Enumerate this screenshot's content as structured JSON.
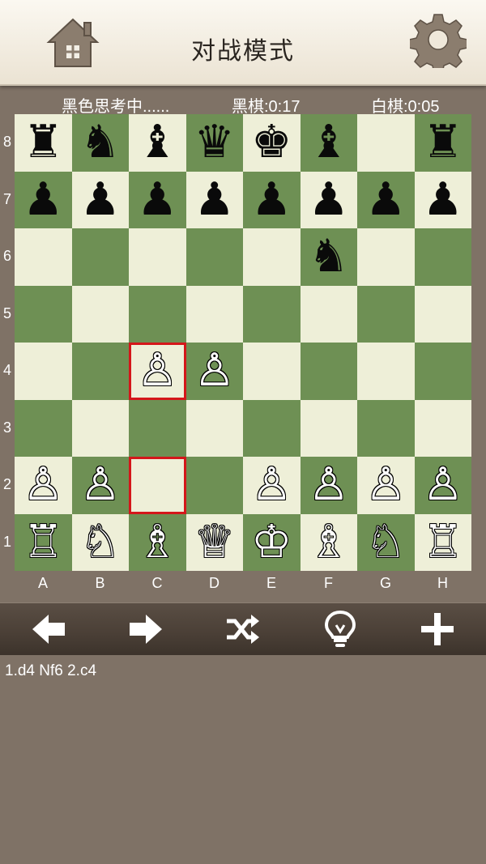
{
  "header": {
    "title": "对战模式",
    "home_icon": "home-icon",
    "settings_icon": "gear-icon"
  },
  "status": {
    "thinking": "黑色思考中......",
    "black_clock": "黑棋:0:17",
    "white_clock": "白棋:0:05"
  },
  "board": {
    "ranks": [
      "8",
      "7",
      "6",
      "5",
      "4",
      "3",
      "2",
      "1"
    ],
    "files": [
      "A",
      "B",
      "C",
      "D",
      "E",
      "F",
      "G",
      "H"
    ],
    "light_color": "#eeefd8",
    "dark_color": "#6e9054",
    "highlight_color": "#d4161a",
    "highlighted_squares": [
      "c4",
      "c2"
    ],
    "position": [
      [
        "br",
        "bn",
        "bb",
        "bq",
        "bk",
        "bb",
        "",
        "br"
      ],
      [
        "bp",
        "bp",
        "bp",
        "bp",
        "bp",
        "bp",
        "bp",
        "bp"
      ],
      [
        "",
        "",
        "",
        "",
        "",
        "bn",
        "",
        ""
      ],
      [
        "",
        "",
        "",
        "",
        "",
        "",
        "",
        ""
      ],
      [
        "",
        "",
        "wp",
        "wp",
        "",
        "",
        "",
        ""
      ],
      [
        "",
        "",
        "",
        "",
        "",
        "",
        "",
        ""
      ],
      [
        "wp",
        "wp",
        "",
        "",
        "wp",
        "wp",
        "wp",
        "wp"
      ],
      [
        "wr",
        "wn",
        "wb",
        "wq",
        "wk",
        "wb",
        "wn",
        "wr"
      ]
    ]
  },
  "toolbar": {
    "buttons": [
      {
        "name": "undo-button",
        "icon": "arrow-left-icon"
      },
      {
        "name": "redo-button",
        "icon": "arrow-right-icon"
      },
      {
        "name": "shuffle-button",
        "icon": "shuffle-icon"
      },
      {
        "name": "hint-button",
        "icon": "lightbulb-icon"
      },
      {
        "name": "new-game-button",
        "icon": "plus-icon"
      }
    ]
  },
  "moves": {
    "text": "1.d4 Nf6 2.c4"
  }
}
